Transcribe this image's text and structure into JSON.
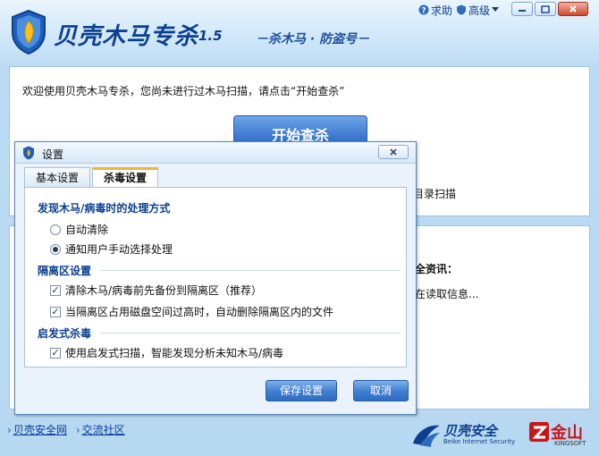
{
  "app": {
    "title": "贝壳木马专杀",
    "version": "1.5",
    "slogan": "－杀木马 · 防盗号－",
    "help_label": "求助",
    "advanced_label": "高级",
    "welcome_text": "欢迎使用贝壳木马专杀，您尚未进行过木马扫描，请点击“开始查杀”",
    "start_button": "开始查杀",
    "dir_scan_text": "目录扫描",
    "news_title": "全资讯：",
    "news_loading": "在读取信息..."
  },
  "footer": {
    "links": [
      "贝壳安全网",
      "交流社区"
    ],
    "beike_brand": "贝壳安全",
    "beike_sub": "Beike Internet Security",
    "kingsoft_brand": "金山",
    "kingsoft_sub": "KINGSOFT"
  },
  "dialog": {
    "title": "设置",
    "tabs": [
      "基本设置",
      "杀毒设置"
    ],
    "active_tab": "杀毒设置",
    "section1": {
      "heading": "发现木马/病毒时的处理方式",
      "options": [
        {
          "label": "自动清除",
          "selected": false
        },
        {
          "label": "通知用户手动选择处理",
          "selected": true
        }
      ]
    },
    "section2": {
      "heading": "隔离区设置",
      "options": [
        {
          "label": "清除木马/病毒前先备份到隔离区（推荐）",
          "checked": true
        },
        {
          "label": "当隔离区占用磁盘空间过高时，自动删除隔离区内的文件",
          "checked": true
        }
      ]
    },
    "section3": {
      "heading": "启发式杀毒",
      "options": [
        {
          "label": "使用启发式扫描，智能发现分析未知木马/病毒",
          "checked": true
        }
      ]
    },
    "save_button": "保存设置",
    "cancel_button": "取消"
  },
  "colors": {
    "brand_blue": "#0d3f8f",
    "button_blue": "#3f7ed0",
    "tab_accent": "#f3b23a",
    "kingsoft_red": "#c8161d"
  },
  "icons": {
    "logo": "shield-icon",
    "help": "help-icon",
    "advanced": "shield-small-icon",
    "minimize": "minimize-icon",
    "maximize": "maximize-icon",
    "close": "close-icon"
  }
}
